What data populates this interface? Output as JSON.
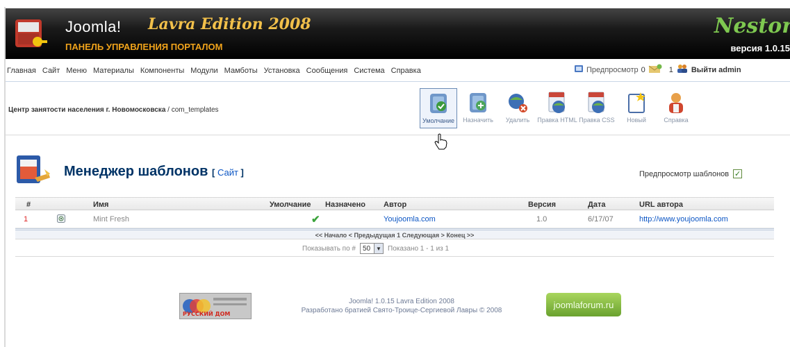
{
  "header": {
    "title": "Joomla!",
    "edition": "Lavra Edition 2008",
    "subtitle": "ПАНЕЛЬ УПРАВЛЕНИЯ ПОРТАЛОМ",
    "brand": "Nestor",
    "version": "версия 1.0.15"
  },
  "menu": {
    "items": [
      "Главная",
      "Сайт",
      "Меню",
      "Материалы",
      "Компоненты",
      "Модули",
      "Мамботы",
      "Установка",
      "Сообщения",
      "Система",
      "Справка"
    ],
    "preview": "Предпросмотр",
    "messages_count": "0",
    "users_count": "1",
    "logout": "Выйти admin"
  },
  "breadcrumb": {
    "site": "Центр занятости населения г. Новомосковска",
    "separator": " / ",
    "component": "com_templates"
  },
  "toolbar": {
    "buttons": [
      {
        "label": "Умолчание",
        "icon": "default-icon"
      },
      {
        "label": "Назначить",
        "icon": "assign-icon"
      },
      {
        "label": "Удалить",
        "icon": "delete-icon"
      },
      {
        "label": "Правка HTML",
        "icon": "edit-html-icon"
      },
      {
        "label": "Правка CSS",
        "icon": "edit-css-icon"
      },
      {
        "label": "Новый",
        "icon": "new-icon"
      },
      {
        "label": "Справка",
        "icon": "help-icon"
      }
    ]
  },
  "manager": {
    "title": "Менеджер шаблонов",
    "client_open": "[",
    "client": "Сайт",
    "client_close": "]",
    "preview_label": "Предпросмотр шаблонов",
    "preview_checked": true
  },
  "table": {
    "columns": [
      "#",
      "Имя",
      "Умолчание",
      "Назначено",
      "Автор",
      "Версия",
      "Дата",
      "URL автора"
    ],
    "rows": [
      {
        "num": "1",
        "name": "Mint Fresh",
        "default": true,
        "assigned": "",
        "author": "Youjoomla.com",
        "version": "1.0",
        "date": "6/17/07",
        "url": "http://www.youjoomla.com"
      }
    ],
    "pager": "<< Начало < Предыдущая 1 Следующая > Конец >>",
    "per_page_label": "Показывать по #",
    "per_page_value": "50",
    "shown": "Показано 1 - 1 из 1"
  },
  "footer": {
    "left_logo_text": "РУССКИЙ ДОМ",
    "line1": "Joomla! 1.0.15 Lavra Edition 2008",
    "line2": "Разработано братией Свято-Троице-Сергиевой Лавры © 2008",
    "right_logo_text": "joomlaforum.ru"
  },
  "colors": {
    "header_bg": "#000000",
    "subtitle": "#f0a31b",
    "brand": "#7ec850",
    "title_blue": "#003366",
    "link_blue": "#0b55c4"
  }
}
